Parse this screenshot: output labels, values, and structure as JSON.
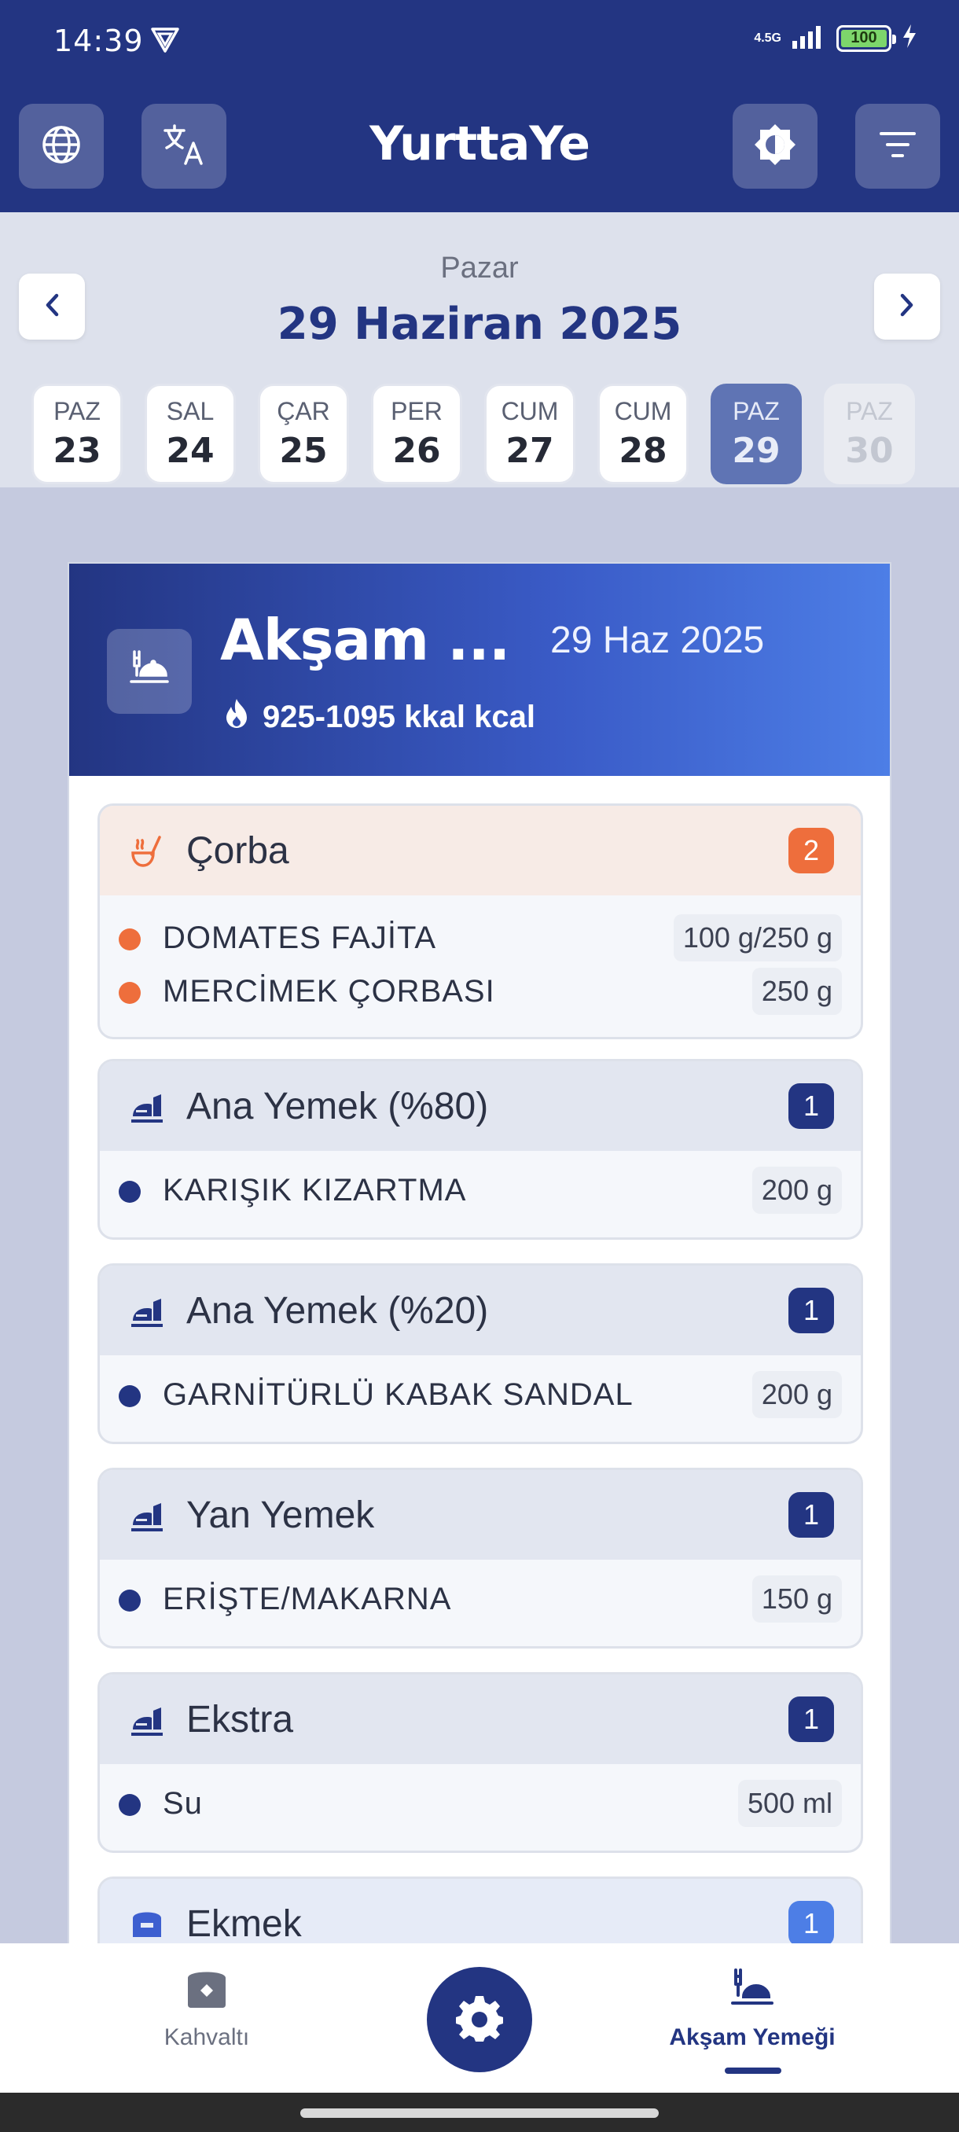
{
  "status_bar": {
    "time": "14:39",
    "network": "4.5G",
    "battery": "100"
  },
  "app_bar": {
    "title": "YurttaYe",
    "icons": [
      "globe-icon",
      "translate-icon",
      "brightness-icon",
      "filter-icon"
    ]
  },
  "date_header": {
    "day_name": "Pazar",
    "full_date": "29 Haziran 2025",
    "days": [
      {
        "abbr": "PAZ",
        "num": "23",
        "state": "normal"
      },
      {
        "abbr": "SAL",
        "num": "24",
        "state": "normal"
      },
      {
        "abbr": "ÇAR",
        "num": "25",
        "state": "normal"
      },
      {
        "abbr": "PER",
        "num": "26",
        "state": "normal"
      },
      {
        "abbr": "CUM",
        "num": "27",
        "state": "normal"
      },
      {
        "abbr": "CUM",
        "num": "28",
        "state": "normal"
      },
      {
        "abbr": "PAZ",
        "num": "29",
        "state": "active"
      },
      {
        "abbr": "PAZ",
        "num": "30",
        "state": "faded"
      }
    ]
  },
  "meal_card": {
    "title": "Akşam ...",
    "date": "29 Haz 2025",
    "calories": "925-1095 kkal kcal",
    "sections": [
      {
        "title": "Çorba",
        "count": "2",
        "items": [
          {
            "name": "DOMATES FAJİTA",
            "qty": "100 g/250 g"
          },
          {
            "name": "MERCİMEK ÇORBASI",
            "qty": "250 g"
          }
        ]
      },
      {
        "title": "Ana Yemek (%80)",
        "count": "1",
        "items": [
          {
            "name": "KARIŞIK KIZARTMA",
            "qty": "200 g"
          }
        ]
      },
      {
        "title": "Ana Yemek (%20)",
        "count": "1",
        "items": [
          {
            "name": "GARNİTÜRLÜ KABAK SANDAL",
            "qty": "200 g"
          }
        ]
      },
      {
        "title": "Yan Yemek",
        "count": "1",
        "items": [
          {
            "name": "ERİŞTE/MAKARNA",
            "qty": "150 g"
          }
        ]
      },
      {
        "title": "Ekstra",
        "count": "1",
        "items": [
          {
            "name": "Su",
            "qty": "500 ml"
          }
        ]
      },
      {
        "title": "Ekmek",
        "count": "1",
        "items": []
      }
    ]
  },
  "bottom_nav": {
    "breakfast_label": "Kahvaltı",
    "dinner_label": "Akşam Yemeği",
    "active": "dinner"
  },
  "colors": {
    "primary": "#233582",
    "accent_orange": "#ee6e3c",
    "active_day": "#5f74b4"
  }
}
